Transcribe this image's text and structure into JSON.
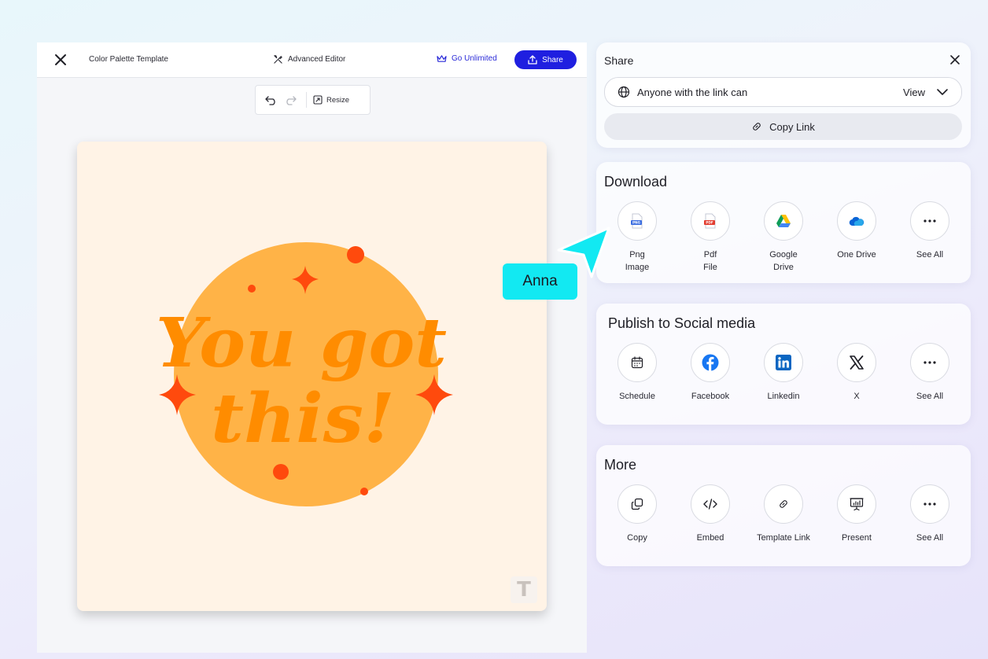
{
  "topbar": {
    "title": "Color Palette Template",
    "advanced_editor": "Advanced Editor",
    "go_unlimited": "Go Unlimited",
    "share": "Share"
  },
  "toolbar": {
    "resize": "Resize"
  },
  "canvas": {
    "line1": "You got",
    "line2": "this!",
    "logo": "T"
  },
  "share_panel": {
    "title": "Share",
    "link_access": "Anyone with the link can",
    "permission": "View",
    "copy_link": "Copy Link"
  },
  "download": {
    "title": "Download",
    "items": [
      {
        "label": "Png\nImage",
        "icon": "png-file-icon"
      },
      {
        "label": "Pdf\nFile",
        "icon": "pdf-file-icon"
      },
      {
        "label": "Google\nDrive",
        "icon": "google-drive-icon"
      },
      {
        "label": "One Drive",
        "icon": "onedrive-icon"
      },
      {
        "label": "See All",
        "icon": "more-dots-icon"
      }
    ]
  },
  "social": {
    "title": "Publish to Social media",
    "items": [
      {
        "label": "Schedule",
        "icon": "calendar-icon"
      },
      {
        "label": "Facebook",
        "icon": "facebook-icon"
      },
      {
        "label": "Linkedin",
        "icon": "linkedin-icon"
      },
      {
        "label": "X",
        "icon": "x-icon"
      },
      {
        "label": "See All",
        "icon": "more-dots-icon"
      }
    ]
  },
  "more": {
    "title": "More",
    "items": [
      {
        "label": "Copy",
        "icon": "copy-icon"
      },
      {
        "label": "Embed",
        "icon": "code-icon"
      },
      {
        "label": "Template Link",
        "icon": "link-icon"
      },
      {
        "label": "Present",
        "icon": "present-icon"
      },
      {
        "label": "See All",
        "icon": "more-dots-icon"
      }
    ]
  },
  "collaborator": {
    "name": "Anna"
  },
  "colors": {
    "accent": "#1f1fe0",
    "canvas_bg": "#fff3e6",
    "circle": "#ffb347",
    "text": "#ff8c00",
    "star": "#ff4a0d",
    "collaborator": "#12e9f2"
  }
}
